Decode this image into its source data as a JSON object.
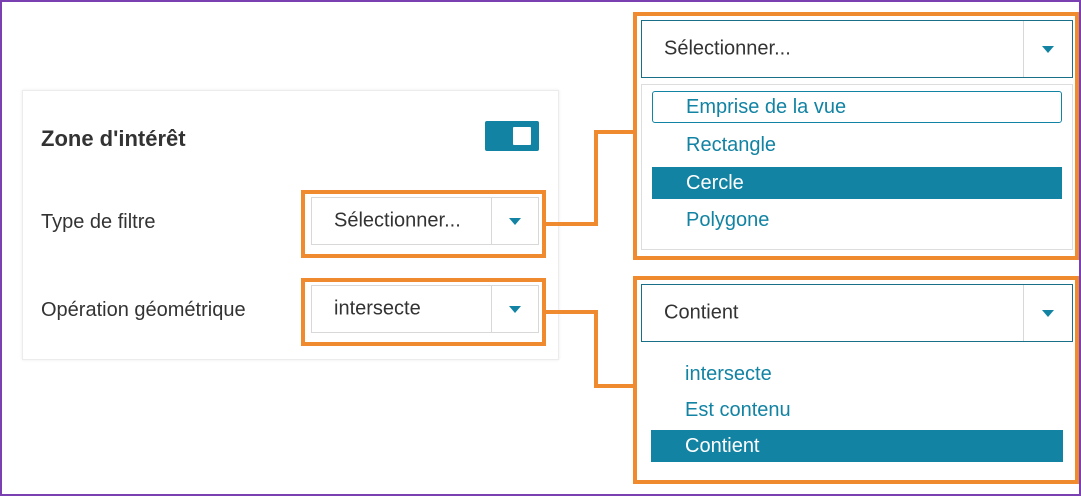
{
  "panel": {
    "title": "Zone d'intérêt",
    "filter_type_label": "Type de filtre",
    "filter_type_value": "Sélectionner...",
    "geo_op_label": "Opération géométrique",
    "geo_op_value": "intersecte"
  },
  "filter_dropdown": {
    "value": "Sélectionner...",
    "options": [
      "Emprise de la vue",
      "Rectangle",
      "Cercle",
      "Polygone"
    ],
    "focused_index": 0,
    "selected_index": 2
  },
  "geo_dropdown": {
    "value": "Contient",
    "options": [
      "intersecte",
      "Est contenu",
      "Contient"
    ],
    "selected_index": 2
  },
  "colors": {
    "accent": "#1283a3",
    "highlight": "#f08a2e",
    "frame": "#7a3fb0"
  }
}
